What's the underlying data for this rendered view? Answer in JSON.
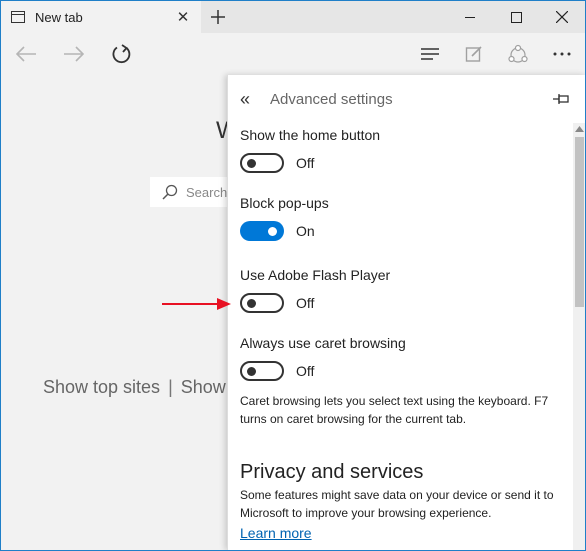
{
  "tab": {
    "title": "New tab"
  },
  "page": {
    "heading_fragment": "W",
    "search_placeholder": "Search",
    "links": [
      "Show top sites",
      "Show"
    ]
  },
  "panel": {
    "title": "Advanced settings",
    "settings": [
      {
        "label": "Show the home button",
        "state": "Off",
        "on": false
      },
      {
        "label": "Block pop-ups",
        "state": "On",
        "on": true
      },
      {
        "label": "Use Adobe Flash Player",
        "state": "Off",
        "on": false
      },
      {
        "label": "Always use caret browsing",
        "state": "Off",
        "on": false
      }
    ],
    "caret_description": "Caret browsing lets you select text using the keyboard. F7 turns on caret browsing for the current tab.",
    "privacy": {
      "heading": "Privacy and services",
      "description": "Some features might save data on your device or send it to Microsoft to improve your browsing experience.",
      "learn_more": "Learn more"
    }
  },
  "colors": {
    "accent": "#0078d7",
    "link": "#0063b1",
    "annotation_arrow": "#e81123",
    "window_border": "#1f7fc8"
  }
}
